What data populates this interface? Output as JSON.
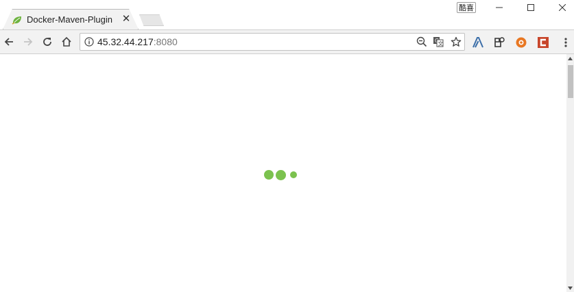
{
  "tab": {
    "title": "Docker-Maven-Plugin",
    "close_glyph": "✕",
    "favicon": "spring-leaf-icon",
    "favicon_color": "#6db33f"
  },
  "profile": {
    "label": "酷喜"
  },
  "omnibox": {
    "host": "45.32.44.217",
    "port": ":8080"
  },
  "loader": {
    "color": "#7bc24e"
  },
  "colors": {
    "extension_orange": "#e87722",
    "extension_red": "#c8462b",
    "extension_blue": "#3b6ea8"
  }
}
